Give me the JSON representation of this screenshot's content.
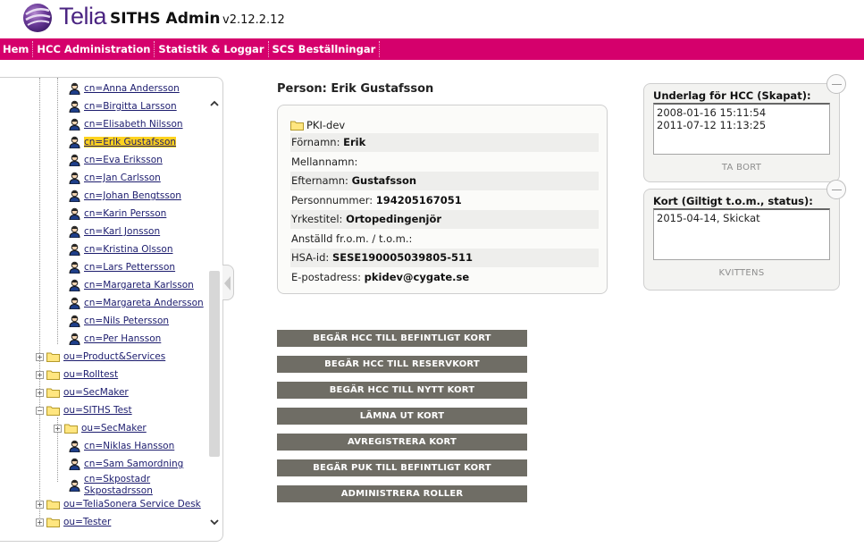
{
  "header": {
    "brand": "Telia",
    "app_title": "SITHS Admin",
    "version": "v2.12.2.12"
  },
  "nav": {
    "items": [
      "Hem",
      "HCC Administration",
      "Statistik & Loggar",
      "SCS Beställningar"
    ]
  },
  "tree": {
    "users_top": [
      "cn=Anna Andersson",
      "cn=Birgitta Larsson",
      "cn=Elisabeth Nilsson",
      "cn=Erik Gustafsson",
      "cn=Eva Eriksson",
      "cn=Jan Carlsson",
      "cn=Johan Bengtsson",
      "cn=Karin Persson",
      "cn=Karl Jonsson",
      "cn=Kristina Olsson",
      "cn=Lars Pettersson",
      "cn=Margareta Karlsson",
      "cn=Margareta Andersson",
      "cn=Nils Petersson",
      "cn=Per Hansson"
    ],
    "selected": "cn=Erik Gustafsson",
    "ou_product": "ou=Product&Services",
    "ou_rolltest": "ou=Rolltest",
    "ou_secmaker": "ou=SecMaker",
    "ou_siths": "ou=SITHS Test",
    "ou_siths_secmaker": "ou=SecMaker",
    "cn_niklas": "cn=Niklas Hansson",
    "cn_sam": "cn=Sam Samordning",
    "cn_skpost_line1": "cn=Skpostadr",
    "cn_skpost_line2": "Skpostadrsson",
    "ou_teliasonera": "ou=TeliaSonera Service Desk",
    "ou_tester": "ou=Tester",
    "expander_plus": "+",
    "expander_minus": "−",
    "scroll_up": "^",
    "scroll_down": "v"
  },
  "person": {
    "title": "Person: Erik Gustafsson",
    "org": "PKI-dev",
    "fields": [
      {
        "label": "Förnamn:",
        "value": "Erik"
      },
      {
        "label": "Mellannamn:",
        "value": ""
      },
      {
        "label": "Efternamn:",
        "value": "Gustafsson"
      },
      {
        "label": "Personnummer:",
        "value": "194205167051"
      },
      {
        "label": "Yrkestitel:",
        "value": "Ortopedingenjör"
      },
      {
        "label": "Anställd fr.o.m. / t.o.m.:",
        "value": ""
      },
      {
        "label": "HSA-id:",
        "value": "SESE190005039805-511"
      },
      {
        "label": "E-postadress:",
        "value": "pkidev@cygate.se"
      }
    ]
  },
  "actions": [
    "BEGÄR HCC TILL BEFINTLIGT KORT",
    "BEGÄR HCC TILL RESERVKORT",
    "BEGÄR HCC TILL NYTT KORT",
    "LÄMNA UT KORT",
    "AVREGISTRERA KORT",
    "BEGÄR PUK TILL BEFINTLIGT KORT",
    "ADMINISTRERA ROLLER"
  ],
  "hcc_box": {
    "title": "Underlag för HCC (Skapat):",
    "entries": [
      "2008-01-16 15:11:54",
      "2011-07-12 11:13:25"
    ],
    "action": "TA BORT"
  },
  "card_box": {
    "title": "Kort (Giltigt t.o.m., status):",
    "entries": [
      "2015-04-14, Skickat"
    ],
    "action": "KVITTENS"
  },
  "colors": {
    "nav_bg": "#d5006c",
    "brand_purple": "#4b2582",
    "button_bg": "#6f6d65",
    "selected_bg": "#ffd21f"
  }
}
